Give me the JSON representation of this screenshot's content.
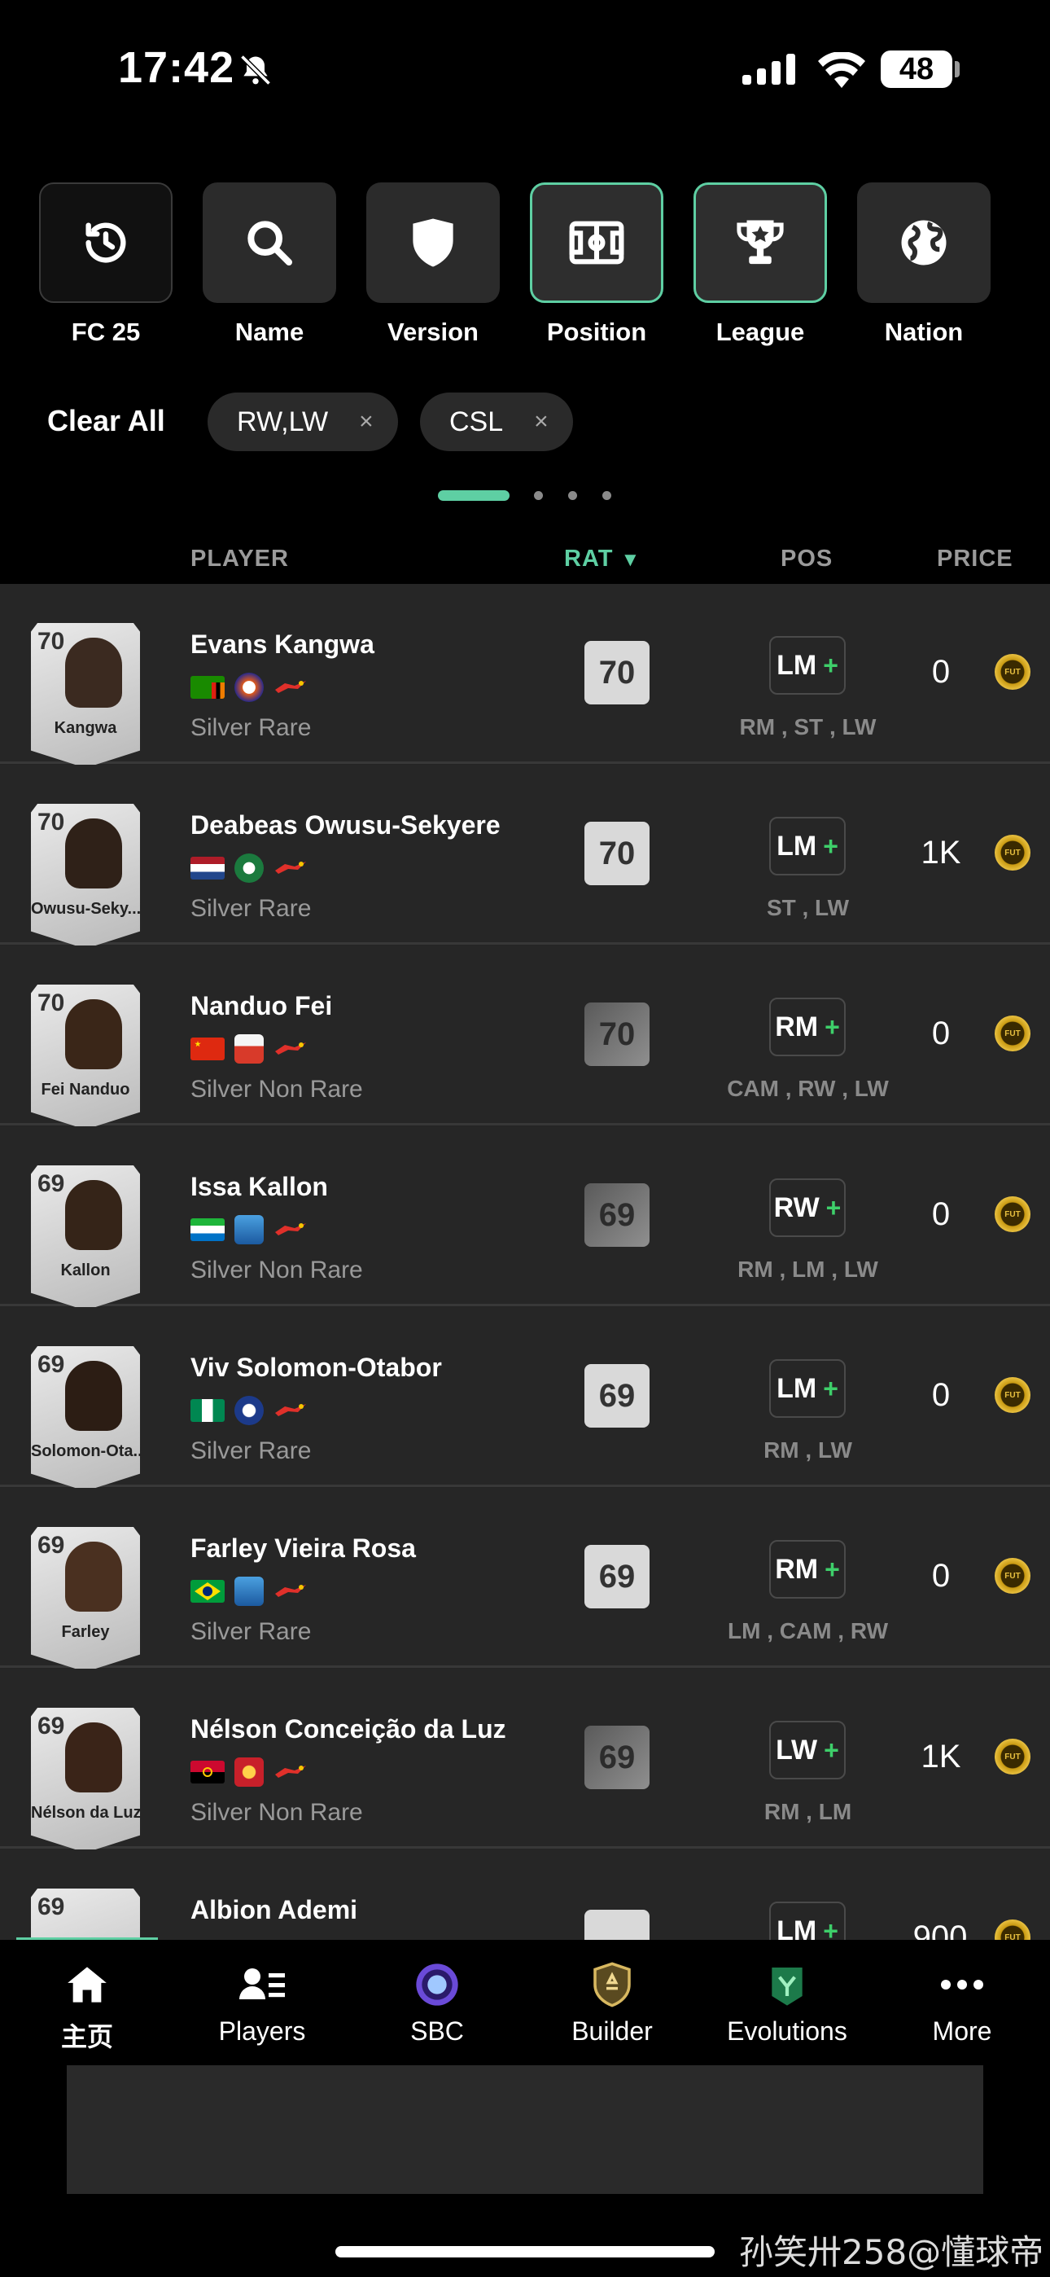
{
  "status_bar": {
    "time": "17:42",
    "battery": "48"
  },
  "filters": [
    {
      "label": "FC 25",
      "icon": "history-icon"
    },
    {
      "label": "Name",
      "icon": "search-icon"
    },
    {
      "label": "Version",
      "icon": "shield-icon"
    },
    {
      "label": "Position",
      "icon": "pitch-icon",
      "active": true
    },
    {
      "label": "League",
      "icon": "trophy-icon",
      "active": true
    },
    {
      "label": "Nation",
      "icon": "globe-icon"
    }
  ],
  "clear_all": "Clear All",
  "chips": [
    {
      "label": "RW,LW"
    },
    {
      "label": "CSL"
    }
  ],
  "chip_remove": "×",
  "table_header": {
    "player": "PLAYER",
    "rat": "RAT",
    "pos": "POS",
    "price": "PRICE",
    "sort_indicator": "▼"
  },
  "players": [
    {
      "card_rating": "70",
      "card_name": "Kangwa",
      "name": "Evans Kangwa",
      "rarity": "Silver Rare",
      "rating": "70",
      "position": "LM",
      "alt_positions": "RM , ST , LW",
      "price": "0"
    },
    {
      "card_rating": "70",
      "card_name": "Owusu-Seky...",
      "name": "Deabeas Owusu-Sekyere",
      "rarity": "Silver Rare",
      "rating": "70",
      "position": "LM",
      "alt_positions": "ST , LW",
      "price": "1K"
    },
    {
      "card_rating": "70",
      "card_name": "Fei Nanduo",
      "name": "Nanduo Fei",
      "rarity": "Silver Non Rare",
      "rating": "70",
      "position": "RM",
      "alt_positions": "CAM , RW , LW",
      "price": "0"
    },
    {
      "card_rating": "69",
      "card_name": "Kallon",
      "name": "Issa Kallon",
      "rarity": "Silver Non Rare",
      "rating": "69",
      "position": "RW",
      "alt_positions": "RM , LM , LW",
      "price": "0"
    },
    {
      "card_rating": "69",
      "card_name": "Solomon-Ota...",
      "name": "Viv Solomon-Otabor",
      "rarity": "Silver Rare",
      "rating": "69",
      "position": "LM",
      "alt_positions": "RM , LW",
      "price": "0"
    },
    {
      "card_rating": "69",
      "card_name": "Farley",
      "name": "Farley Vieira Rosa",
      "rarity": "Silver Rare",
      "rating": "69",
      "position": "RM",
      "alt_positions": "LM , CAM , RW",
      "price": "0"
    },
    {
      "card_rating": "69",
      "card_name": "Nélson da Luz",
      "name": "Nélson Conceição da Luz",
      "rarity": "Silver Non Rare",
      "rating": "69",
      "position": "LW",
      "alt_positions": "RM , LM",
      "price": "1K"
    },
    {
      "card_rating": "69",
      "card_name": "",
      "name": "Albion Ademi",
      "rarity": "",
      "rating": "",
      "position": "LM",
      "alt_positions": "",
      "price": "900"
    }
  ],
  "coin_label": "FUT",
  "plus_sign": "+",
  "bottom_nav": [
    {
      "label": "主页",
      "icon": "home-icon",
      "active": true
    },
    {
      "label": "Players",
      "icon": "players-icon"
    },
    {
      "label": "SBC",
      "icon": "sbc-icon"
    },
    {
      "label": "Builder",
      "icon": "builder-icon"
    },
    {
      "label": "Evolutions",
      "icon": "evolutions-icon"
    },
    {
      "label": "More",
      "icon": "more-icon"
    }
  ],
  "watermark": "孙笑卅258@懂球帝",
  "colors": {
    "accent": "#5ecfa3",
    "plus": "#3ecf6a",
    "coin": "#e8c040",
    "row_bg": "#262626"
  }
}
